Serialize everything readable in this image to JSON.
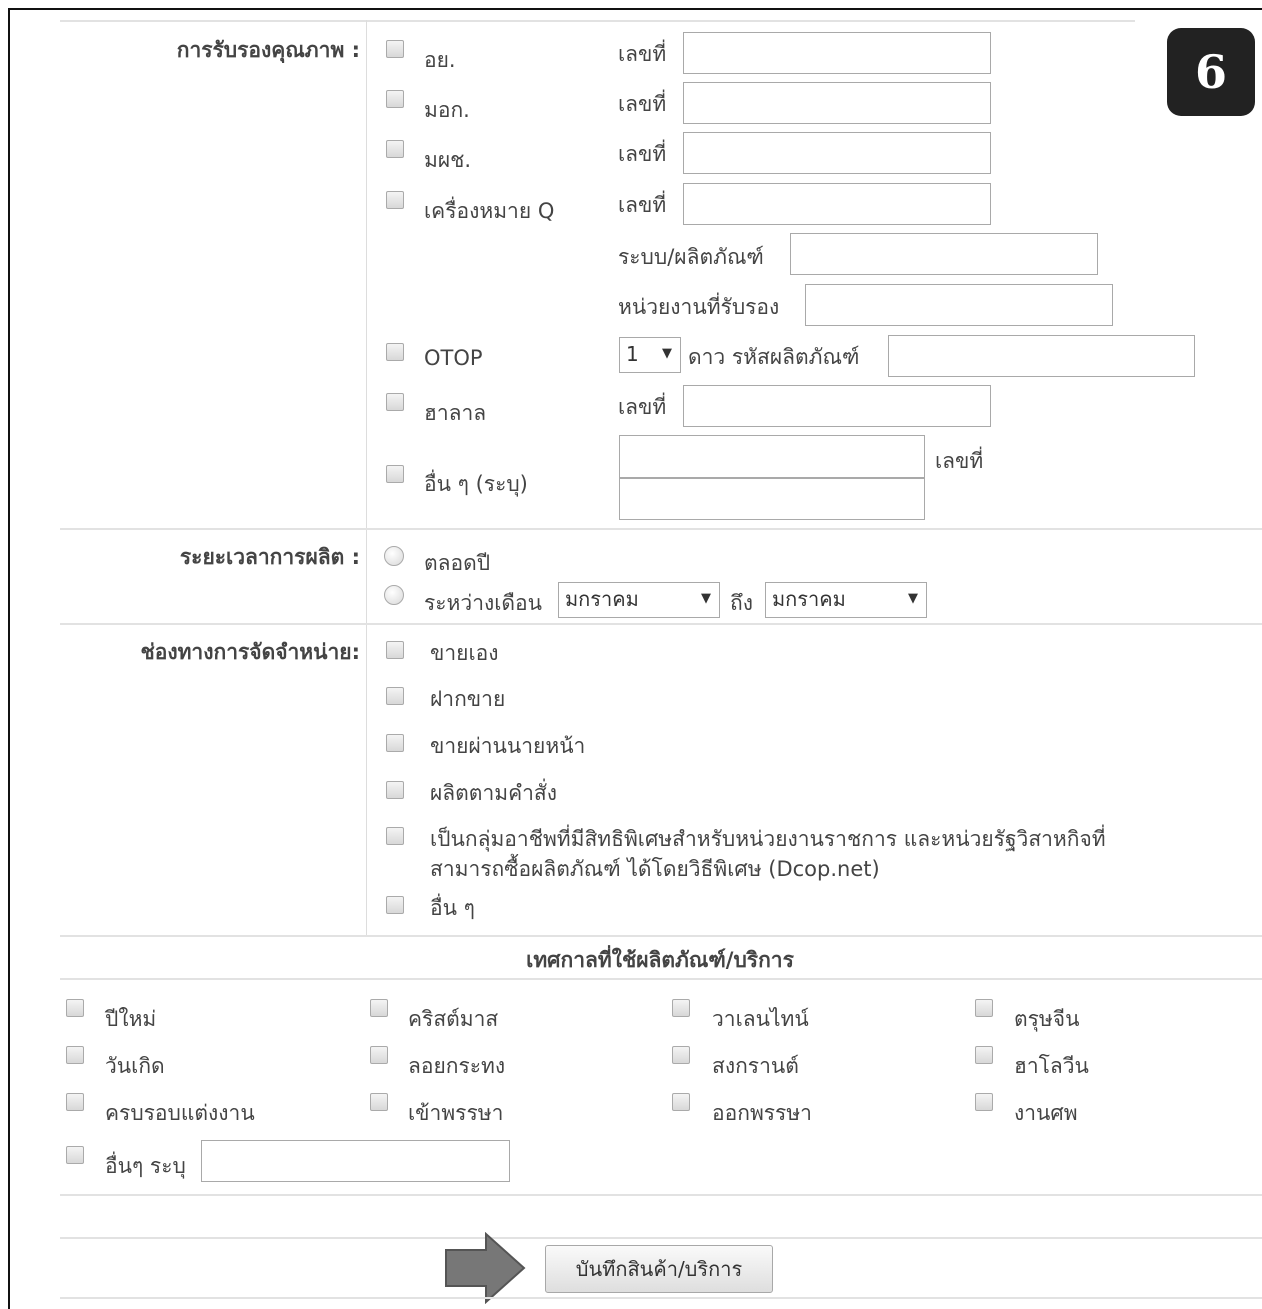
{
  "page_badge": "6",
  "certification": {
    "label": "การรับรองคุณภาพ :",
    "number_label": "เลขที่",
    "items": [
      {
        "label": "อย."
      },
      {
        "label": "มอก."
      },
      {
        "label": "มผช."
      },
      {
        "label": "เครื่องหมาย Q"
      },
      {
        "label": "OTOP"
      },
      {
        "label": "ฮาลาล"
      },
      {
        "label": "อื่น ๆ (ระบุ)"
      }
    ],
    "system_product_label": "ระบบ/ผลิตภัณฑ์",
    "certifying_agency_label": "หน่วยงานที่รับรอง",
    "otop_star_value": "1",
    "otop_star_label": "ดาว รหัสผลิตภัณฑ์"
  },
  "production_period": {
    "label": "ระยะเวลาการผลิต :",
    "options": [
      "ตลอดปี",
      "ระหว่างเดือน"
    ],
    "from_month": "มกราคม",
    "to_label": "ถึง",
    "to_month": "มกราคม"
  },
  "distribution": {
    "label": "ช่องทางการจัดจำหน่าย:",
    "items": [
      "ขายเอง",
      "ฝากขาย",
      "ขายผ่านนายหน้า",
      "ผลิตตามคำสั่ง",
      "เป็นกลุ่มอาชีพที่มีสิทธิพิเศษสำหรับหน่วยงานราชการ และหน่วยรัฐวิสาหกิจที่",
      "อื่น ๆ"
    ],
    "dcop_line2": "สามารถซื้อผลิตภัณฑ์ ได้โดยวิธีพิเศษ (Dcop.net)"
  },
  "festivals": {
    "title": "เทศกาลที่ใช้ผลิตภัณฑ์/บริการ",
    "items": [
      "ปีใหม่",
      "คริสต์มาส",
      "วาเลนไทน์",
      "ตรุษจีน",
      "วันเกิด",
      "ลอยกระทง",
      "สงกรานต์",
      "ฮาโลวีน",
      "ครบรอบแต่งงาน",
      "เข้าพรรษา",
      "ออกพรรษา",
      "งานศพ"
    ],
    "other_label": "อื่นๆ ระบุ"
  },
  "save_button": "บันทึกสินค้า/บริการ"
}
